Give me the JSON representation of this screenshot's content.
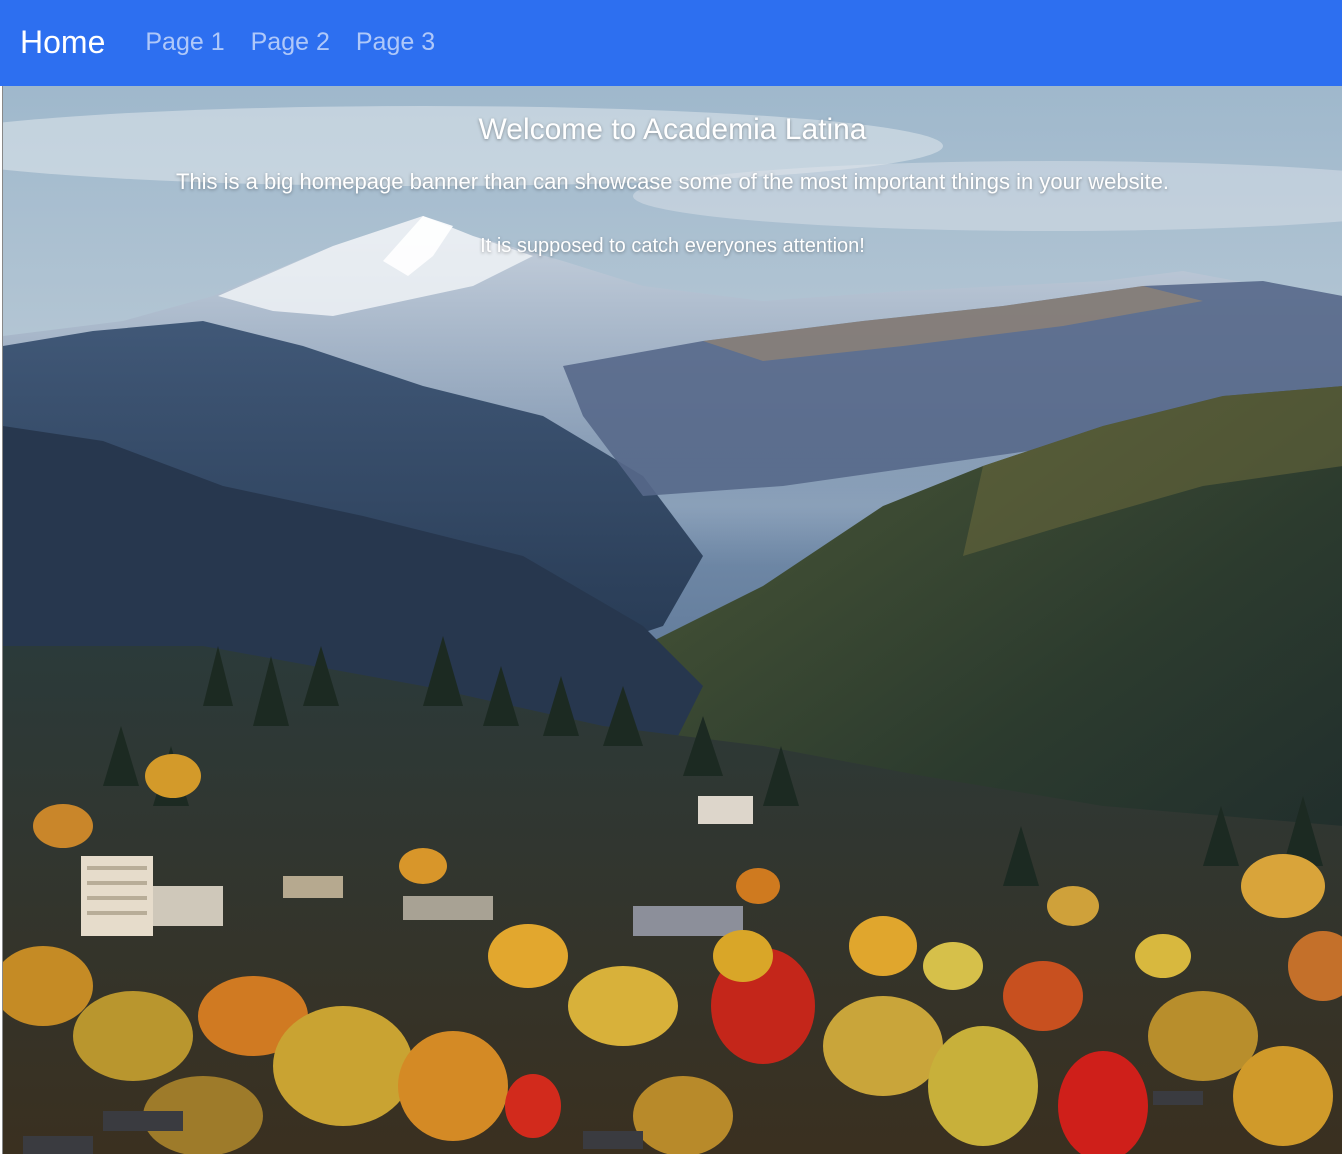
{
  "navbar": {
    "brand": "Home",
    "links": [
      {
        "label": "Page 1"
      },
      {
        "label": "Page 2"
      },
      {
        "label": "Page 3"
      }
    ],
    "bg_color": "#2d6ff0"
  },
  "banner": {
    "title": "Welcome to Academia Latina",
    "subtitle": "This is a big homepage banner than can showcase some of the most important things in your website.",
    "tagline": "It is supposed to catch everyones attention!",
    "image": "mountain-town-autumn-landscape"
  }
}
